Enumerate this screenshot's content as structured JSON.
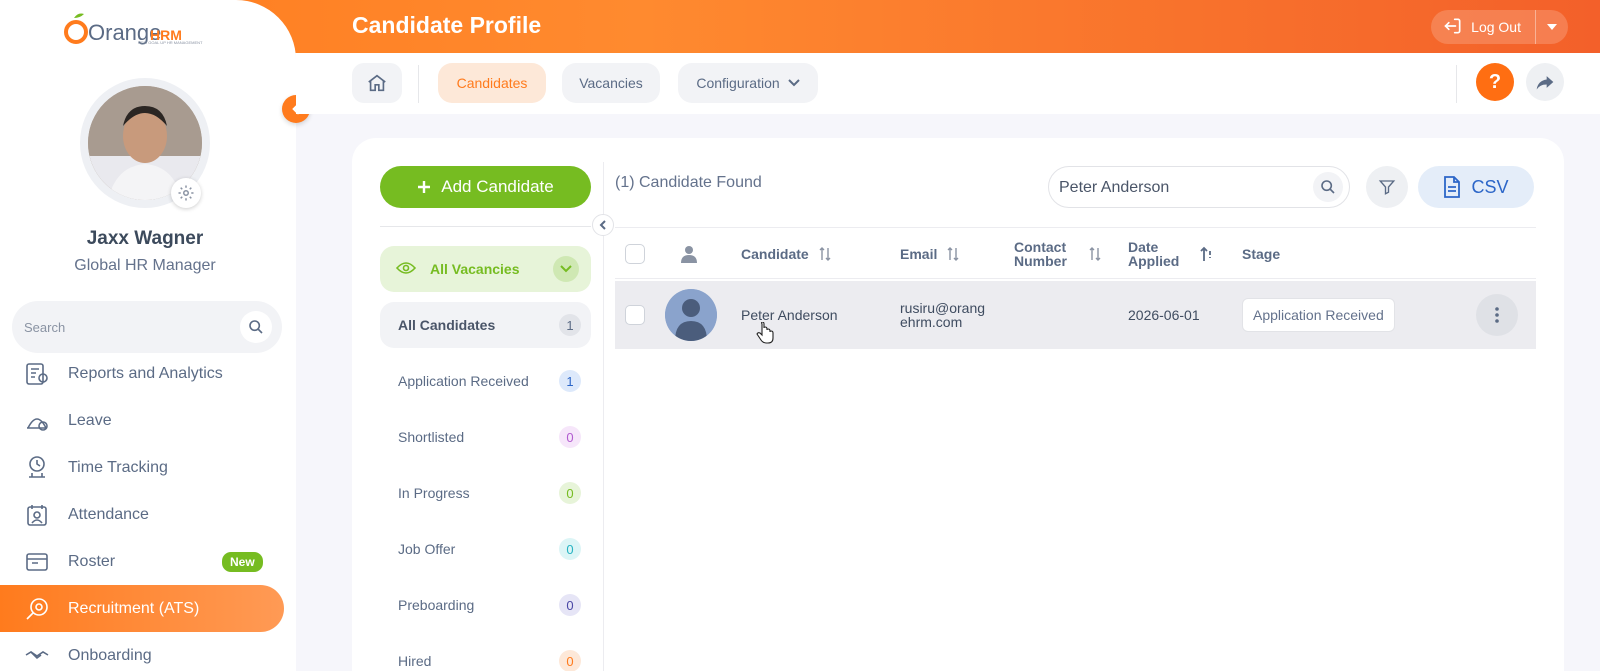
{
  "header": {
    "title": "Candidate Profile",
    "logout_label": "Log Out"
  },
  "brand": {
    "logo_text": "Orange",
    "logo_text_2": "HRM",
    "logo_tagline": "HRM GOAL UP HR MANAGEMENT",
    "accent": "#ff7b1d",
    "green": "#76bc21"
  },
  "user": {
    "name": "Jaxx Wagner",
    "role": "Global HR Manager"
  },
  "sidebar": {
    "search_placeholder": "Search",
    "items": [
      {
        "label": "Reports and Analytics",
        "icon": "reports-icon"
      },
      {
        "label": "Leave",
        "icon": "leave-icon"
      },
      {
        "label": "Time Tracking",
        "icon": "time-tracking-icon"
      },
      {
        "label": "Attendance",
        "icon": "attendance-icon"
      },
      {
        "label": "Roster",
        "icon": "roster-icon",
        "badge": "New"
      },
      {
        "label": "Recruitment (ATS)",
        "icon": "recruitment-icon",
        "active": true
      },
      {
        "label": "Onboarding",
        "icon": "onboarding-icon"
      }
    ]
  },
  "nav": {
    "tabs": [
      {
        "label": "Candidates",
        "active": true
      },
      {
        "label": "Vacancies"
      },
      {
        "label": "Configuration"
      }
    ],
    "help_label": "?"
  },
  "main": {
    "add_button": "Add Candidate",
    "vacancy_filter": "All Vacancies",
    "stages": [
      {
        "label": "All Candidates",
        "count": "1",
        "bg": "#e2e4e9",
        "fg": "#5b6b85"
      },
      {
        "label": "Application Received",
        "count": "1",
        "bg": "#dde9fb",
        "fg": "#2c66c8"
      },
      {
        "label": "Shortlisted",
        "count": "0",
        "bg": "#f6e6fa",
        "fg": "#b25cd0"
      },
      {
        "label": "In Progress",
        "count": "0",
        "bg": "#e7f4d9",
        "fg": "#76bc21"
      },
      {
        "label": "Job Offer",
        "count": "0",
        "bg": "#dcf5f6",
        "fg": "#27b3c2"
      },
      {
        "label": "Preboarding",
        "count": "0",
        "bg": "#e6e5f6",
        "fg": "#4b48a6"
      },
      {
        "label": "Hired",
        "count": "0",
        "bg": "#fde8d8",
        "fg": "#ff7b1d"
      }
    ],
    "found_text": "(1) Candidate Found",
    "search_value": "Peter Anderson",
    "csv_label": "CSV",
    "table": {
      "headers": {
        "candidate": "Candidate",
        "email": "Email",
        "contact_1": "Contact",
        "contact_2": "Number",
        "date_1": "Date",
        "date_2": "Applied",
        "stage": "Stage"
      },
      "rows": [
        {
          "candidate": "Peter Anderson",
          "email_1": "rusiru@orang",
          "email_2": "ehrm.com",
          "contact": "",
          "date_applied": "2026-06-01",
          "stage": "Application Received"
        }
      ]
    }
  }
}
